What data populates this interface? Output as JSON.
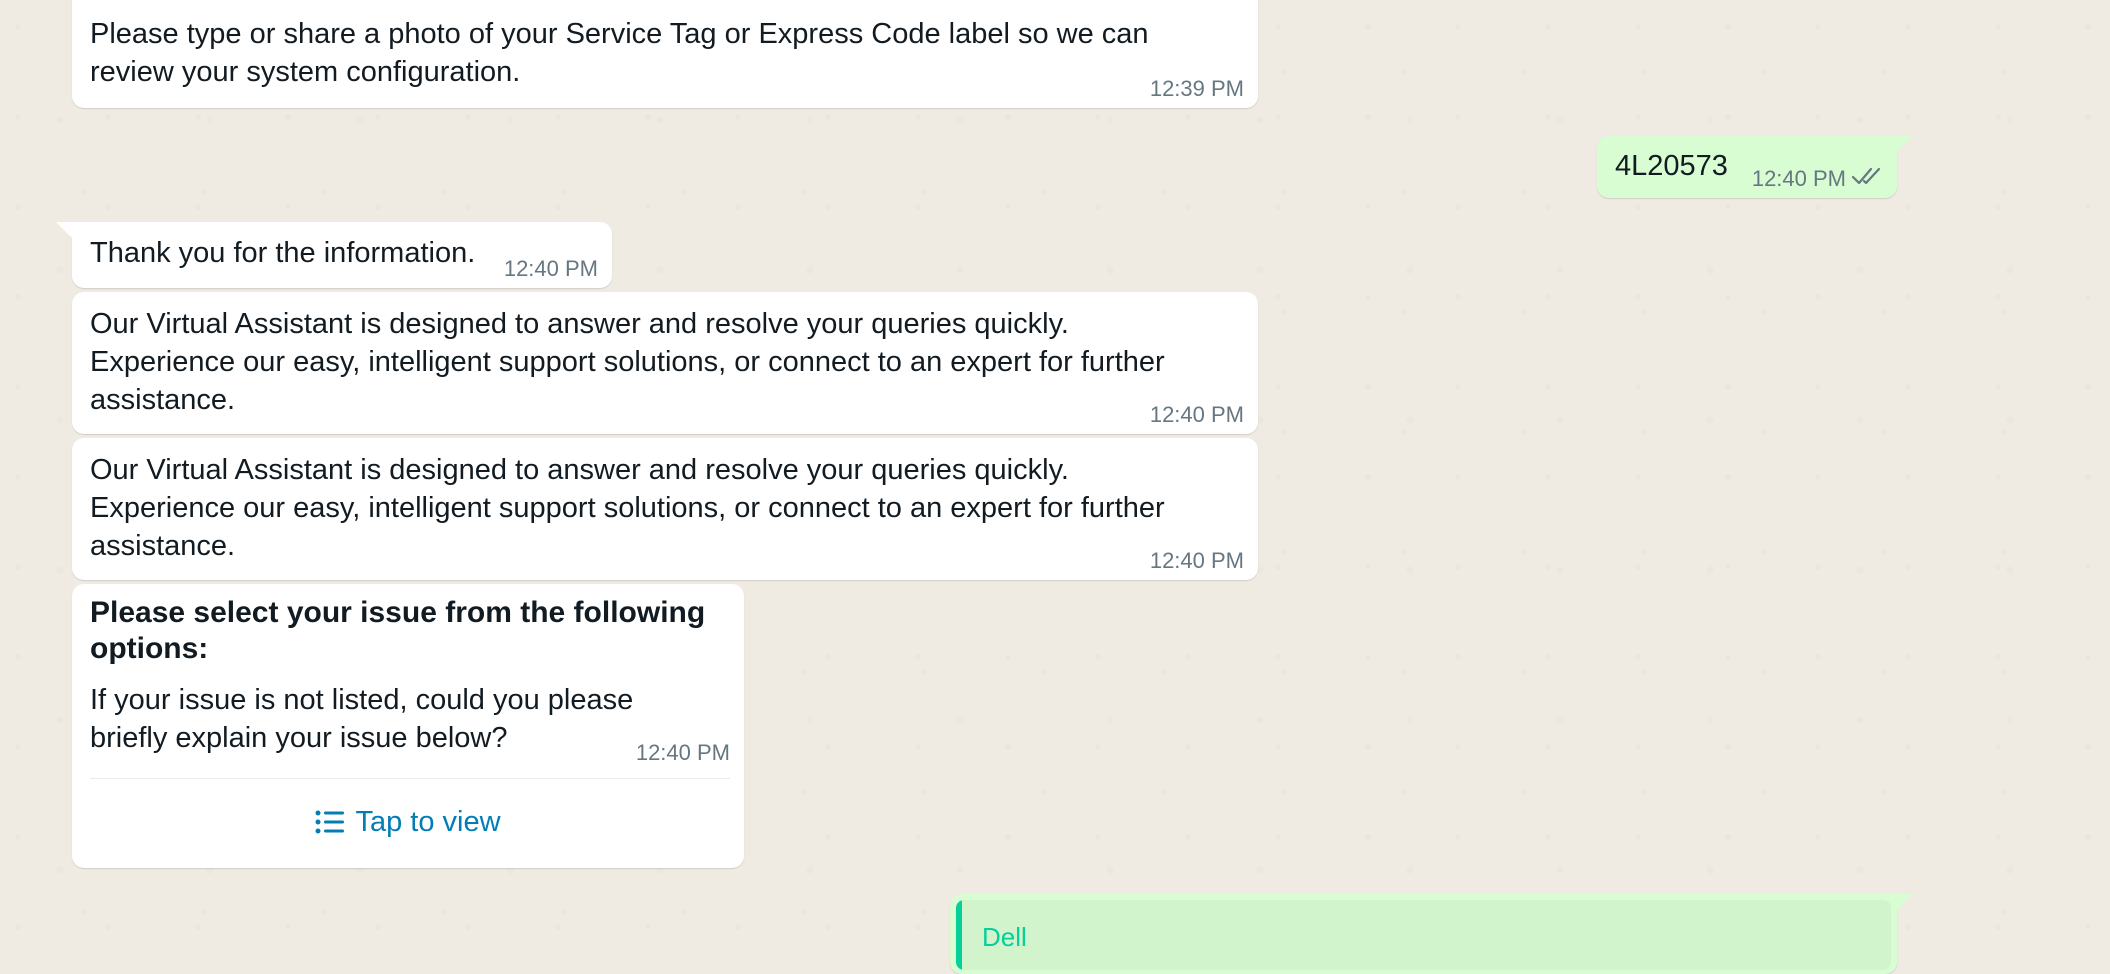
{
  "messages": [
    {
      "id": "m1",
      "direction": "incoming",
      "text": "Please type or share a photo of your Service Tag or Express Code label so we can\nreview your system configuration.",
      "time": "12:39 PM"
    },
    {
      "id": "m2",
      "direction": "outgoing",
      "text": "4L20573",
      "time": "12:40 PM",
      "status": "read"
    },
    {
      "id": "m3",
      "direction": "incoming",
      "text": "Thank you for the information.",
      "time": "12:40 PM"
    },
    {
      "id": "m4",
      "direction": "incoming",
      "text": "Our Virtual Assistant is designed to answer and resolve your queries quickly.\nExperience our easy, intelligent support solutions, or connect to an expert for further\nassistance.",
      "time": "12:40 PM"
    },
    {
      "id": "m5",
      "direction": "incoming",
      "text": "Our Virtual Assistant is designed to answer and resolve your queries quickly.\nExperience our easy, intelligent support solutions, or connect to an expert for further\nassistance.",
      "time": "12:40 PM"
    },
    {
      "id": "m6",
      "direction": "incoming",
      "type": "list",
      "title": "Please select your issue from the following\noptions:",
      "text": "If your issue is not listed, could you please\nbriefly explain your issue below?",
      "time": "12:40 PM",
      "button_label": "Tap to view",
      "button_icon": "list-icon"
    },
    {
      "id": "m7",
      "direction": "outgoing",
      "type": "reply",
      "quote_author": "Dell"
    }
  ],
  "colors": {
    "chat_background": "#efeae2",
    "incoming_bubble": "#ffffff",
    "outgoing_bubble": "#d9fdd3",
    "timestamp": "#667781",
    "read_ticks": "#53bdeb",
    "link_blue": "#027eb5",
    "quote_accent": "#06cf9c"
  }
}
